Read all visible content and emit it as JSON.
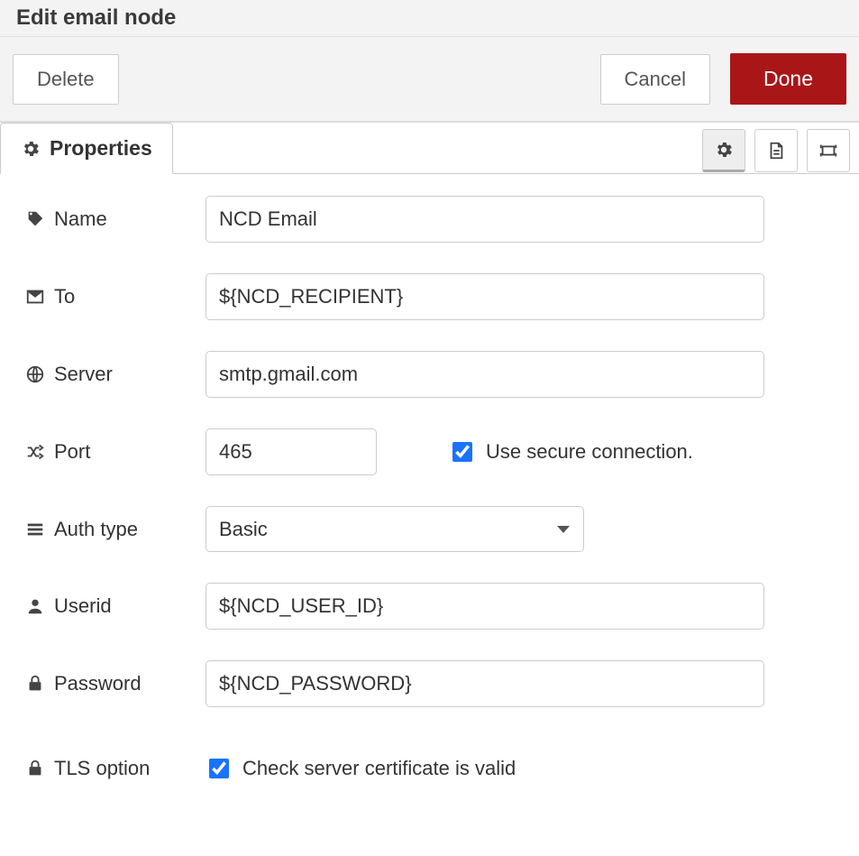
{
  "header": {
    "title": "Edit email node"
  },
  "buttons": {
    "delete": "Delete",
    "cancel": "Cancel",
    "done": "Done"
  },
  "tab": {
    "label": "Properties"
  },
  "fields": {
    "name": {
      "label": "Name",
      "value": "NCD Email"
    },
    "to": {
      "label": "To",
      "value": "${NCD_RECIPIENT}"
    },
    "server": {
      "label": "Server",
      "value": "smtp.gmail.com"
    },
    "port": {
      "label": "Port",
      "value": "465"
    },
    "secure": {
      "label": "Use secure connection.",
      "checked": true
    },
    "authtype": {
      "label": "Auth type",
      "value": "Basic"
    },
    "userid": {
      "label": "Userid",
      "value": "${NCD_USER_ID}"
    },
    "password": {
      "label": "Password",
      "value": "${NCD_PASSWORD}"
    },
    "tls": {
      "label": "TLS option",
      "check_label": "Check server certificate is valid",
      "checked": true
    }
  }
}
